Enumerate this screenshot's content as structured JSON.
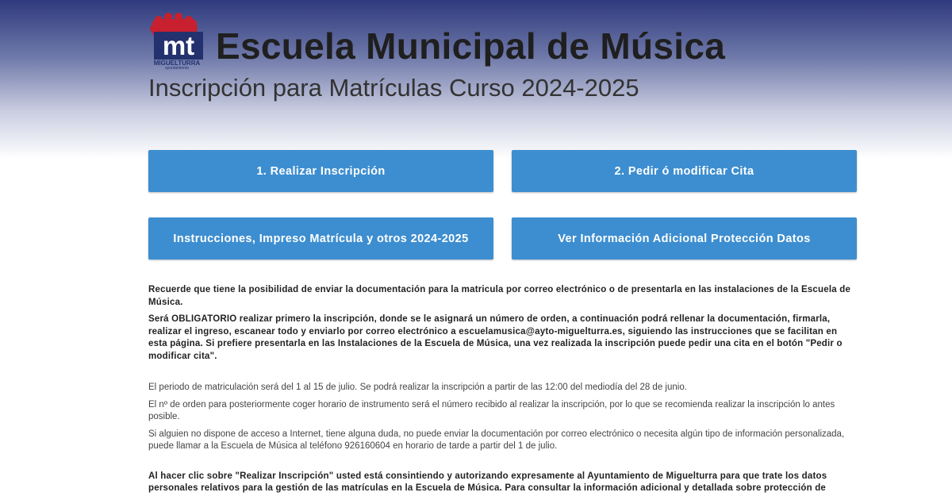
{
  "header": {
    "logo": {
      "letters": "mt",
      "town": "MIGUELTURRA",
      "caption": "ayuntamiento"
    },
    "title": "Escuela Municipal de Música",
    "subtitle": "Inscripción para Matrículas Curso 2024-2025"
  },
  "buttons": [
    {
      "label": "1. Realizar Inscripción"
    },
    {
      "label": "2. Pedir ó modificar Cita"
    },
    {
      "label": "Instrucciones, Impreso Matrícula y otros 2024-2025"
    },
    {
      "label": "Ver Información Adicional Protección Datos"
    }
  ],
  "content": {
    "p1": "Recuerde que tiene la posibilidad de enviar la documentación para la matricula por correo electrónico o de presentarla en las instalaciones de la Escuela de Música.",
    "p2": "Será OBLIGATORIO realizar primero la inscripción, donde se le asignará un número de orden, a continuación podrá rellenar la documentación, firmarla, realizar el ingreso, escanear todo y enviarlo por correo electrónico a escuelamusica@ayto-miguelturra.es, siguiendo las instrucciones que se facilitan en esta página. Si prefiere presentarla en las Instalaciones de la Escuela de Música, una vez realizada la inscripción puede pedir una cita en el botón \"Pedir o modificar cita\".",
    "p3": "El periodo de matriculación será del 1 al 15 de julio. Se podrá realizar la inscripción a partir de las 12:00 del mediodía del 28 de junio.",
    "p4": "El nº de orden para posteriormente coger horario de instrumento será el número recibido al realizar la inscripción, por lo que se recomienda realizar la inscripción lo antes posible.",
    "p5": "Si alguien no dispone de acceso a Internet, tiene alguna duda, no puede enviar la documentación por correo electrónico o necesita algún tipo de información personalizada, puede llamar a la Escuela de Música al teléfono 926160604 en horario de tarde a partir del 1 de julio.",
    "p6": "Al hacer clic sobre \"Realizar Inscripción\" usted está consintiendo y autorizando expresamente al Ayuntamiento de Miguelturra para que trate los datos personales relativos para la gestión de las matrículas en la Escuela de Música. Para consultar la información adicional y detallada sobre protección de"
  },
  "colors": {
    "button_bg": "#3d8ed0",
    "logo_red": "#c8202f",
    "logo_navy": "#23326e",
    "header_gradient_top": "#2e3a7d"
  }
}
